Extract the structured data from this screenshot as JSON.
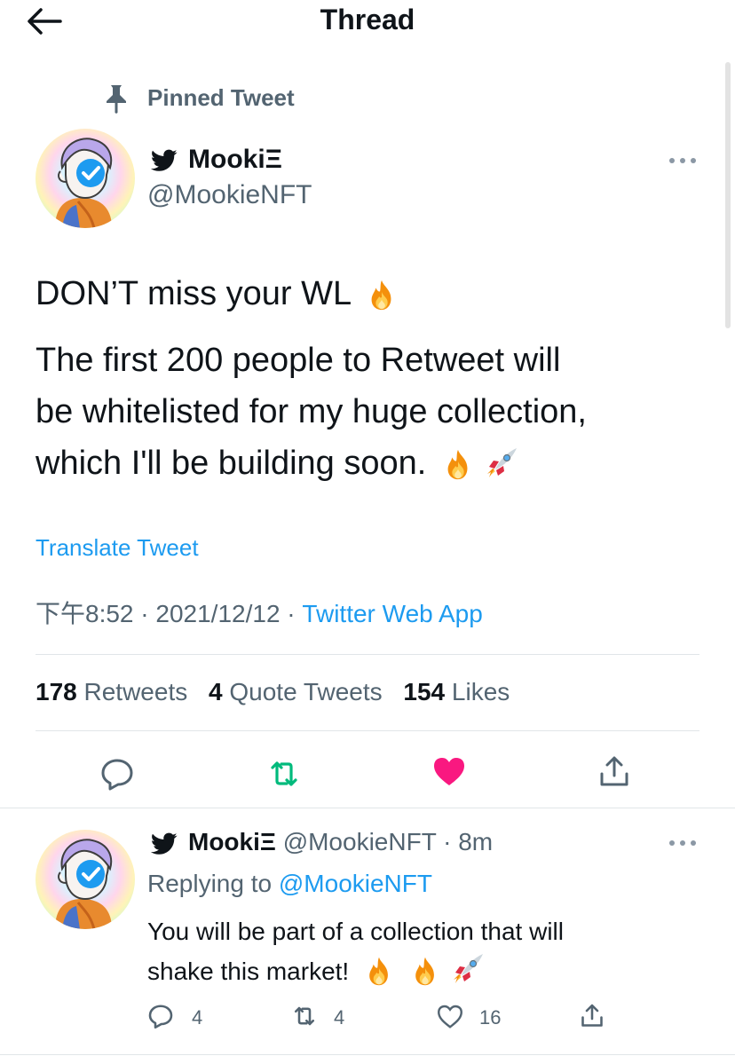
{
  "header": {
    "title": "Thread",
    "back_icon": "arrow-left-icon"
  },
  "pinned": {
    "label": "Pinned Tweet",
    "icon": "pin-icon"
  },
  "tweet": {
    "author_name": "MookiΞ",
    "author_handle": "@MookieNFT",
    "lines": [
      "DON’T miss your WL",
      "The first 200 people to Retweet will",
      "be whitelisted for my huge collection,",
      "which I'll be building soon."
    ],
    "emojis": [
      "fire-emoji",
      "fire-emoji",
      "rocket-emoji"
    ],
    "translate_label": "Translate Tweet",
    "time": "下午8:52",
    "date": "2021/12/12",
    "source": "Twitter Web App",
    "separator": " · ",
    "stats": {
      "retweets_count": "178",
      "retweets_label": "Retweets",
      "quotes_count": "4",
      "quotes_label": "Quote Tweets",
      "likes_count": "154",
      "likes_label": "Likes"
    },
    "liked": true
  },
  "reply": {
    "author_name": "MookiΞ",
    "author_handle": "@MookieNFT",
    "time_ago": "8m",
    "replying_prefix": "Replying to",
    "replying_to": "@MookieNFT",
    "lines": [
      "You will be part of a collection that will",
      "shake this market!"
    ],
    "reply_count": "4",
    "retweet_count": "4",
    "like_count": "16"
  },
  "colors": {
    "accent": "#1d9bf0",
    "like": "#f91880",
    "retweet": "#00ba7c",
    "muted": "#536471",
    "text": "#0f1419"
  }
}
